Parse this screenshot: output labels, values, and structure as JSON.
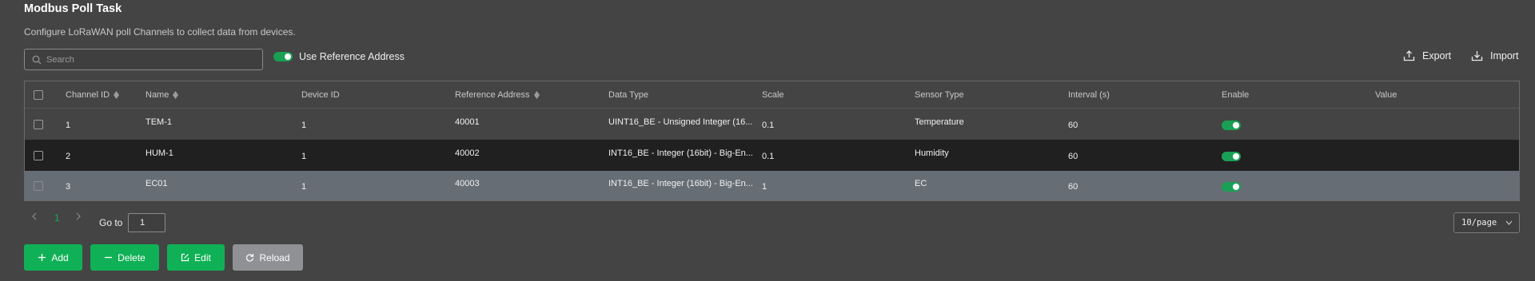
{
  "header": {
    "title": "Modbus Poll Task",
    "subtitle": "Configure LoRaWAN poll Channels to collect data from devices."
  },
  "search": {
    "placeholder": "Search",
    "value": ""
  },
  "reference_toggle": {
    "label": "Use Reference Address",
    "enabled": true
  },
  "actions": {
    "export_label": "Export",
    "import_label": "Import"
  },
  "table": {
    "columns": [
      "Channel ID",
      "Name",
      "Device ID",
      "Reference Address",
      "Data Type",
      "Scale",
      "Sensor Type",
      "Interval (s)",
      "Enable",
      "Value"
    ],
    "rows": [
      {
        "channel_id": "1",
        "name": "TEM-1",
        "device_id": "1",
        "reference_address": "40001",
        "data_type": "UINT16_BE - Unsigned Integer (16...",
        "scale": "0.1",
        "sensor_type": "Temperature",
        "interval": "60",
        "enable": true,
        "value": ""
      },
      {
        "channel_id": "2",
        "name": "HUM-1",
        "device_id": "1",
        "reference_address": "40002",
        "data_type": "INT16_BE - Integer (16bit) - Big-En...",
        "scale": "0.1",
        "sensor_type": "Humidity",
        "interval": "60",
        "enable": true,
        "value": ""
      },
      {
        "channel_id": "3",
        "name": "EC01",
        "device_id": "1",
        "reference_address": "40003",
        "data_type": "INT16_BE - Integer (16bit) - Big-En...",
        "scale": "1",
        "sensor_type": "EC",
        "interval": "60",
        "enable": true,
        "value": ""
      }
    ]
  },
  "pagination": {
    "current_page": "1",
    "goto_label": "Go to",
    "goto_value": "1",
    "page_size": "10/page"
  },
  "buttons": {
    "add": "Add",
    "delete": "Delete",
    "edit": "Edit",
    "reload": "Reload"
  },
  "colors": {
    "accent": "#10b156",
    "background": "#444444",
    "selected_row": "#676d75",
    "dark_row": "#202020"
  }
}
